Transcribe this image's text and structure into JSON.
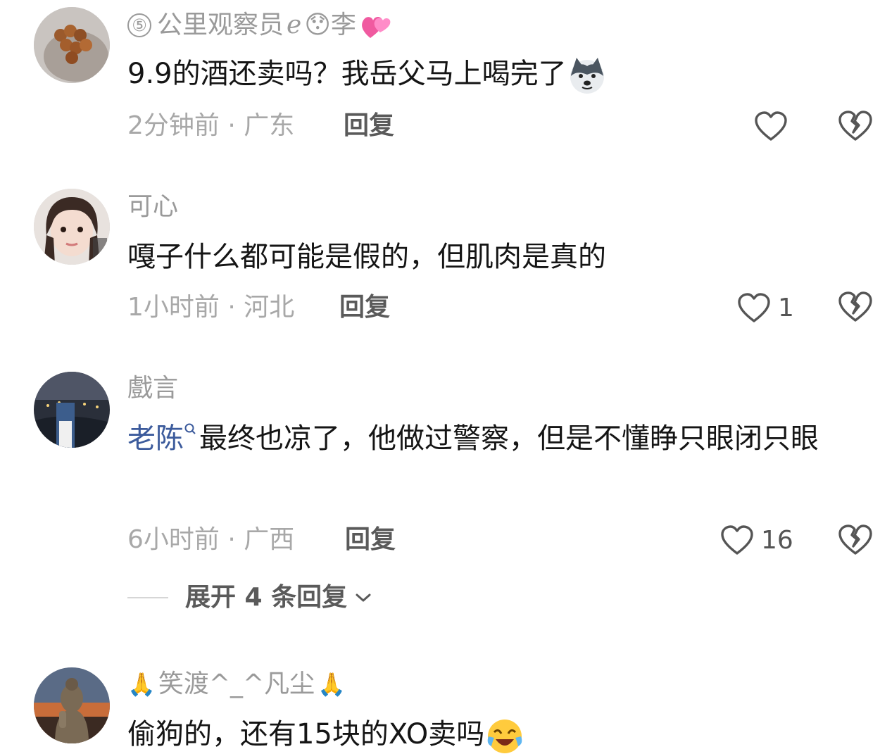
{
  "comments": [
    {
      "username_badge": "⑤",
      "username": "公里观察员",
      "username_suffix": "ℯ",
      "username_sym": "😯",
      "username_tail": "李",
      "text": "9.9的酒还卖吗？我岳父马上喝完了",
      "time": "2分钟前",
      "location": "广东",
      "reply_label": "回复",
      "like_count": ""
    },
    {
      "username": "可心",
      "text": "嘎子什么都可能是假的，但肌肉是真的",
      "time": "1小时前",
      "location": "河北",
      "reply_label": "回复",
      "like_count": "1"
    },
    {
      "username": "戲言",
      "mention": "老陈",
      "text": "最终也凉了，他做过警察，但是不懂睁只眼闭只眼",
      "time": "6小时前",
      "location": "广西",
      "reply_label": "回复",
      "like_count": "16"
    },
    {
      "username_prefix": "🙏",
      "username": "笑渡^_^凡尘",
      "username_suffix": "🙏",
      "text": "偷狗的，还有15块的XO卖吗",
      "time": "",
      "location": "",
      "reply_label": "",
      "like_count": ""
    }
  ],
  "expand_replies": "展开 4 条回复",
  "meta_separator": " · ",
  "colors": {
    "mention": "#3c5b9c",
    "meta": "#a8a8a8",
    "text": "#151515"
  }
}
